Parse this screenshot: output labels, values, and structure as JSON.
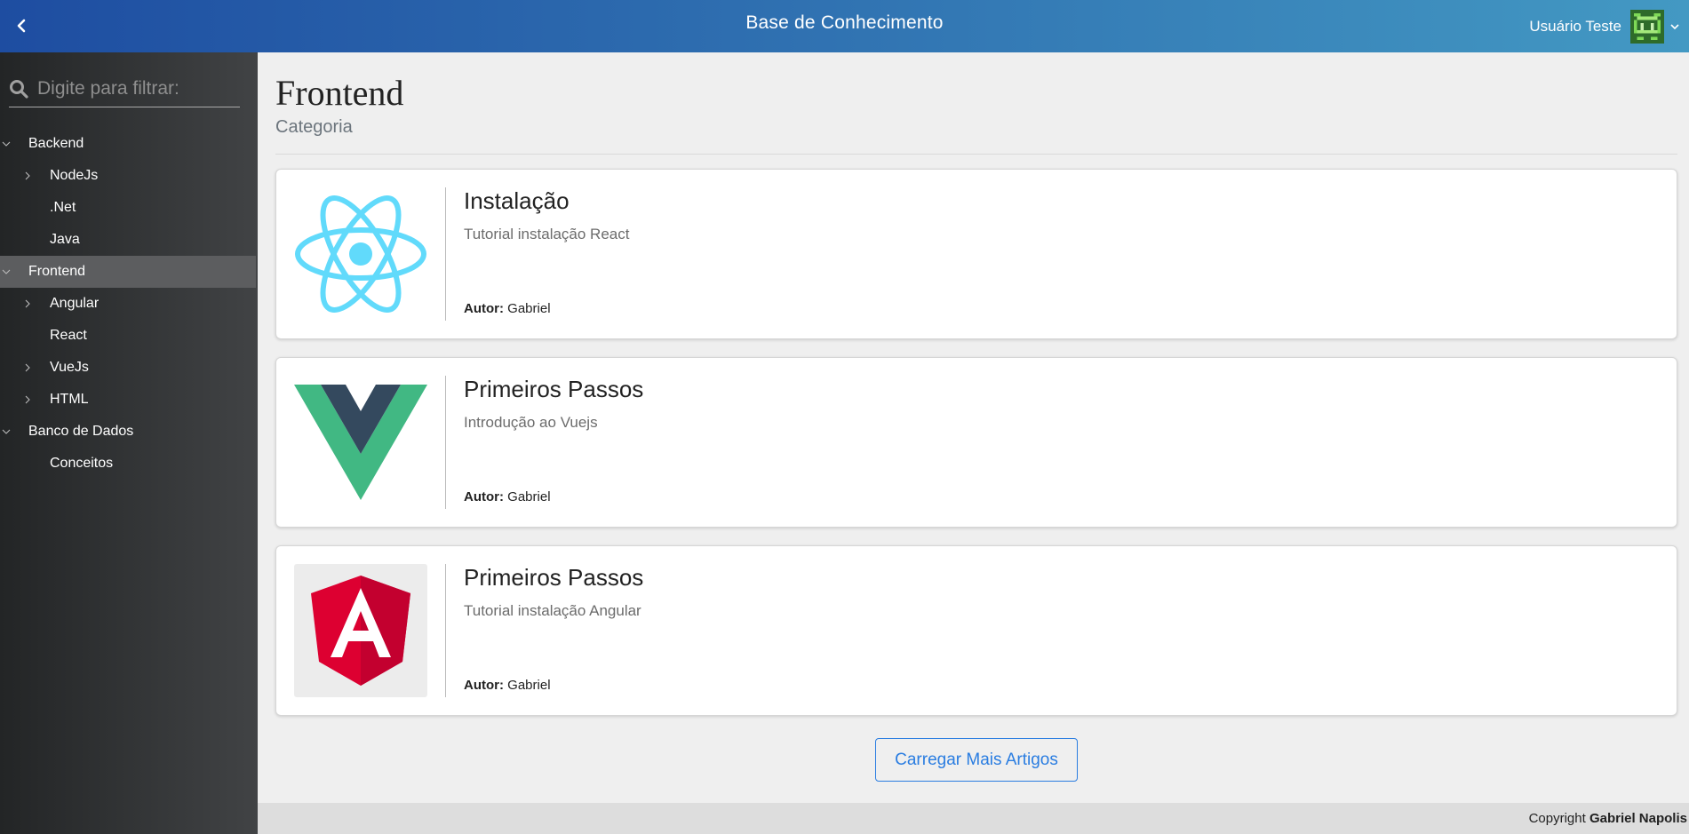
{
  "header": {
    "title": "Base de Conhecimento",
    "user_name": "Usuário Teste"
  },
  "sidebar": {
    "search_placeholder": "Digite para filtrar:",
    "items": [
      {
        "label": "Backend",
        "level": 0,
        "expanded": true
      },
      {
        "label": "NodeJs",
        "level": 1,
        "has_children": true
      },
      {
        "label": ".Net",
        "level": 1,
        "has_children": false
      },
      {
        "label": "Java",
        "level": 1,
        "has_children": false
      },
      {
        "label": "Frontend",
        "level": 0,
        "expanded": true,
        "active": true
      },
      {
        "label": "Angular",
        "level": 1,
        "has_children": true
      },
      {
        "label": "React",
        "level": 1,
        "has_children": false
      },
      {
        "label": "VueJs",
        "level": 1,
        "has_children": true
      },
      {
        "label": "HTML",
        "level": 1,
        "has_children": true
      },
      {
        "label": "Banco de Dados",
        "level": 0,
        "expanded": true
      },
      {
        "label": "Conceitos",
        "level": 1,
        "has_children": false
      }
    ]
  },
  "main": {
    "title": "Frontend",
    "subtitle": "Categoria",
    "articles": [
      {
        "title": "Instalação",
        "description": "Tutorial instalação React",
        "author_label": "Autor:",
        "author": "Gabriel",
        "logo": "react-logo"
      },
      {
        "title": "Primeiros Passos",
        "description": "Introdução ao Vuejs",
        "author_label": "Autor:",
        "author": "Gabriel",
        "logo": "vue-logo"
      },
      {
        "title": "Primeiros Passos",
        "description": "Tutorial instalação Angular",
        "author_label": "Autor:",
        "author": "Gabriel",
        "logo": "angular-logo"
      }
    ],
    "load_more_label": "Carregar Mais Artigos"
  },
  "footer": {
    "prefix": "Copyright",
    "author": "Gabriel Napolis"
  },
  "colors": {
    "header_gradient_start": "#1e4da1",
    "header_gradient_end": "#4399c3",
    "sidebar_bg": "#232526",
    "accent": "#2a7de1",
    "react": "#61dafb",
    "vue_green": "#41b883",
    "vue_dark": "#34495e",
    "angular_red": "#dd0031"
  }
}
